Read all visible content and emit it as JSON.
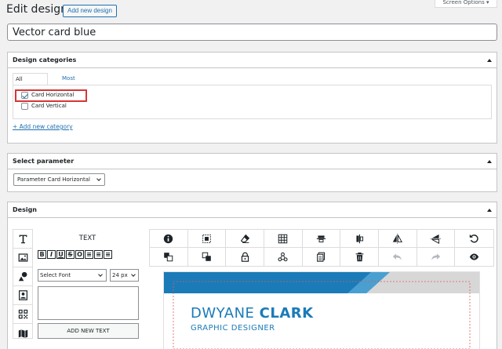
{
  "page": {
    "title": "Edit design",
    "add_new_label": "Add new design",
    "screen_options": "Screen Options ▾",
    "design_name": "Vector card blue"
  },
  "categories": {
    "heading": "Design categories",
    "tabs": [
      "All categories",
      "Most Used"
    ],
    "items": [
      {
        "label": "Card Horizontal",
        "checked": true
      },
      {
        "label": "Card Vertical",
        "checked": false
      }
    ],
    "add_link": "+ Add new category"
  },
  "parameter": {
    "heading": "Select parameter",
    "selected": "Parameter Card Horizontal"
  },
  "design": {
    "heading": "Design",
    "text_panel": {
      "heading": "TEXT",
      "format_buttons": [
        "B",
        "I",
        "U",
        "S",
        "O",
        "≡",
        "≡",
        "≡"
      ],
      "font_select": "Select Font",
      "size_select": "24 px",
      "add_button": "ADD NEW TEXT"
    },
    "left_tools": [
      "text-tool-icon",
      "image-tool-icon",
      "shapes-tool-icon",
      "portrait-tool-icon",
      "qrcode-tool-icon",
      "map-tool-icon"
    ],
    "toolbar_icons": [
      "info-icon",
      "select-area-icon",
      "eraser-icon",
      "grid-icon",
      "align-center-h-icon",
      "align-center-v-icon",
      "flip-horizontal-icon",
      "flip-vertical-icon",
      "reset-icon",
      "bring-forward-icon",
      "send-backward-icon",
      "lock-icon",
      "group-icon",
      "duplicate-icon",
      "trash-icon",
      "undo-icon",
      "redo-icon",
      "preview-icon"
    ],
    "card": {
      "first_name": "DWYANE",
      "last_name": "CLARK",
      "job_title": "GRAPHIC DESIGNER"
    }
  },
  "colors": {
    "accent": "#2271b1",
    "card_blue": "#1a7bb8",
    "card_grey": "#d7d7d7",
    "highlight": "#d63638"
  }
}
